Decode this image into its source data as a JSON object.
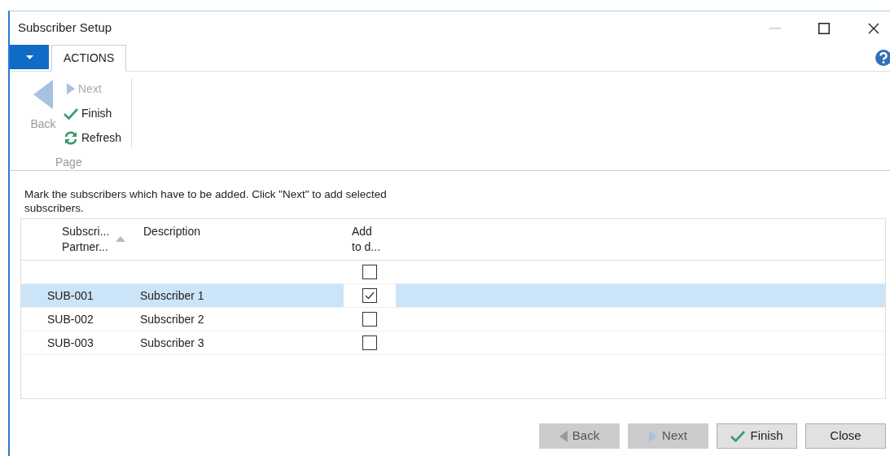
{
  "window": {
    "title": "Subscriber Setup"
  },
  "ribbon": {
    "tabs": [
      {
        "label": "ACTIONS",
        "selected": true
      }
    ],
    "large_action": {
      "label": "Back",
      "disabled": true
    },
    "actions": [
      {
        "label": "Next",
        "kind": "next",
        "disabled": true
      },
      {
        "label": "Finish",
        "kind": "finish",
        "disabled": false
      },
      {
        "label": "Refresh",
        "kind": "refresh",
        "disabled": false
      }
    ],
    "group_label": "Page"
  },
  "instruction": "Mark the subscribers which have to be added. Click \"Next\" to add selected subscribers.",
  "table": {
    "columns": [
      {
        "label": "Subscri... Partner...",
        "sorted": true
      },
      {
        "label": "Description",
        "sorted": false
      },
      {
        "label": "Add to d...",
        "sorted": false
      }
    ],
    "rows": [
      {
        "checked": false,
        "selected": false
      },
      {
        "code": "SUB-001",
        "description": "Subscriber 1",
        "checked": true,
        "selected": true
      },
      {
        "code": "SUB-002",
        "description": "Subscriber 2",
        "checked": false,
        "selected": false
      },
      {
        "code": "SUB-003",
        "description": "Subscriber 3",
        "checked": false,
        "selected": false
      }
    ]
  },
  "buttons": [
    {
      "label": "Back",
      "kind": "back",
      "disabled": true
    },
    {
      "label": "Next",
      "kind": "next",
      "disabled": true
    },
    {
      "label": "Finish",
      "kind": "finish",
      "disabled": false
    },
    {
      "label": "Close",
      "kind": "plain",
      "disabled": false
    }
  ]
}
